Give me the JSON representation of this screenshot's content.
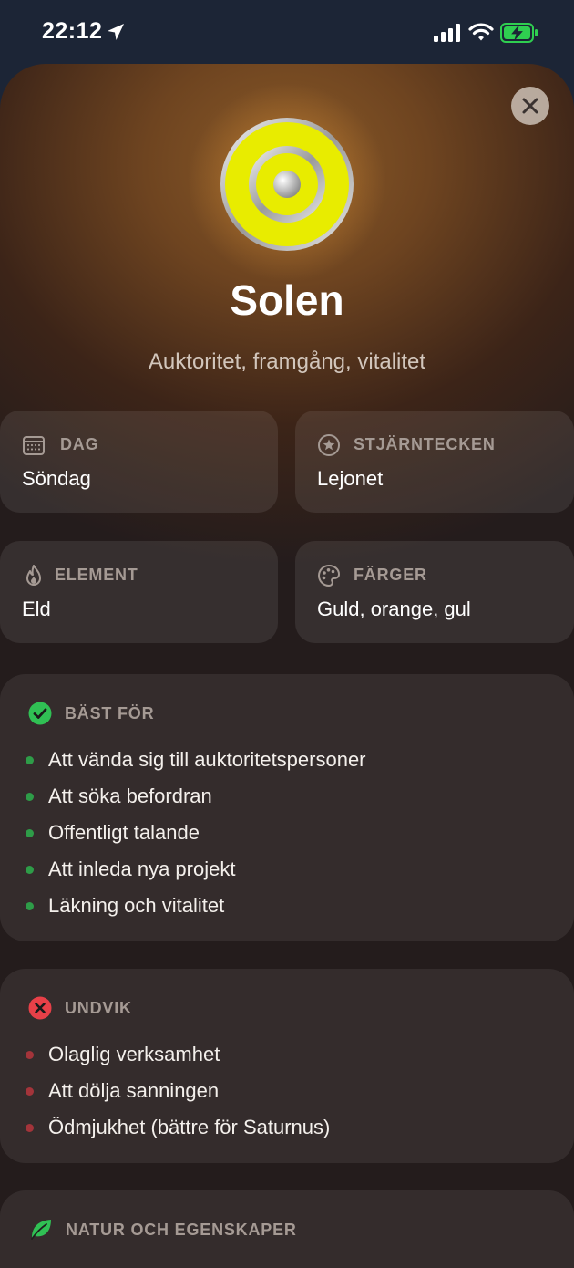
{
  "status_bar": {
    "time": "22:12"
  },
  "header": {
    "title": "Solen",
    "subtitle": "Auktoritet, framgång, vitalitet"
  },
  "info": {
    "day": {
      "label": "DAG",
      "value": "Söndag",
      "icon": "calendar-icon"
    },
    "sign": {
      "label": "STJÄRNTECKEN",
      "value": "Lejonet",
      "icon": "star-circle-icon"
    },
    "element": {
      "label": "ELEMENT",
      "value": "Eld",
      "icon": "flame-icon"
    },
    "colors": {
      "label": "FÄRGER",
      "value": "Guld, orange, gul",
      "icon": "palette-icon"
    }
  },
  "best_for": {
    "label": "BÄST FÖR",
    "icon": "checkmark-circle-icon",
    "accent": "#30c054",
    "items": [
      "Att vända sig till auktoritetspersoner",
      "Att söka befordran",
      "Offentligt talande",
      "Att inleda nya projekt",
      "Läkning och vitalitet"
    ]
  },
  "avoid": {
    "label": "UNDVIK",
    "icon": "x-circle-icon",
    "accent": "#e84048",
    "items": [
      "Olaglig verksamhet",
      "Att dölja sanningen",
      "Ödmjukhet (bättre för Saturnus)"
    ]
  },
  "nature": {
    "label": "NATUR OCH EGENSKAPER",
    "icon": "leaf-icon",
    "accent": "#30c054"
  }
}
